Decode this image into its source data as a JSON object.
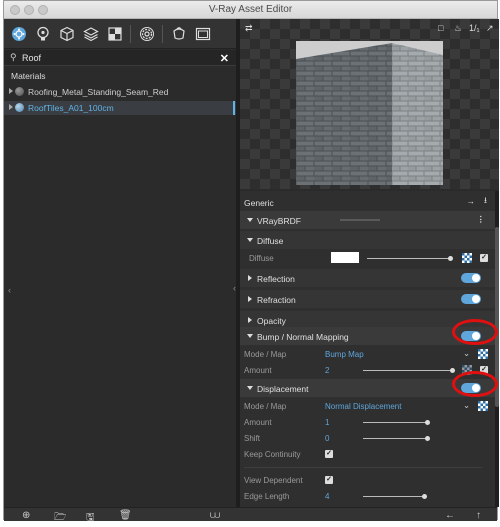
{
  "window": {
    "title": "V-Ray Asset Editor"
  },
  "toolbar": {
    "icons": [
      "materials-icon",
      "lights-icon",
      "geometry-icon",
      "layers-icon",
      "render-elements-icon",
      "settings-icon",
      "render-icon",
      "frame-buffer-icon"
    ]
  },
  "search": {
    "value": "Roof"
  },
  "materials": {
    "section_label": "Materials",
    "items": [
      {
        "name": "Roofing_Metal_Standing_Seam_Red",
        "selected": false
      },
      {
        "name": "RoofTiles_A01_100cm",
        "selected": true
      }
    ]
  },
  "preview": {
    "toolbar_right": "1/₁"
  },
  "properties": {
    "generic_label": "Generic",
    "brdf_label": "VRayBRDF",
    "diffuse_header": "Diffuse",
    "diffuse_label": "Diffuse",
    "diffuse_color": "#ffffff",
    "reflection_header": "Reflection",
    "refraction_header": "Refraction",
    "opacity_header": "Opacity",
    "bump_header": "Bump / Normal Mapping",
    "bump_mode_label": "Mode / Map",
    "bump_mode_value": "Bump Map",
    "bump_amount_label": "Amount",
    "bump_amount_value": "2",
    "displacement_header": "Displacement",
    "disp_mode_label": "Mode / Map",
    "disp_mode_value": "Normal Displacement",
    "disp_amount_label": "Amount",
    "disp_amount_value": "1",
    "disp_shift_label": "Shift",
    "disp_shift_value": "0",
    "keep_continuity_label": "Keep Continuity",
    "view_dependent_label": "View Dependent",
    "edge_length_label": "Edge Length",
    "edge_length_value": "4"
  },
  "colors": {
    "accent": "#5fa6dc",
    "highlight": "#e01010"
  }
}
